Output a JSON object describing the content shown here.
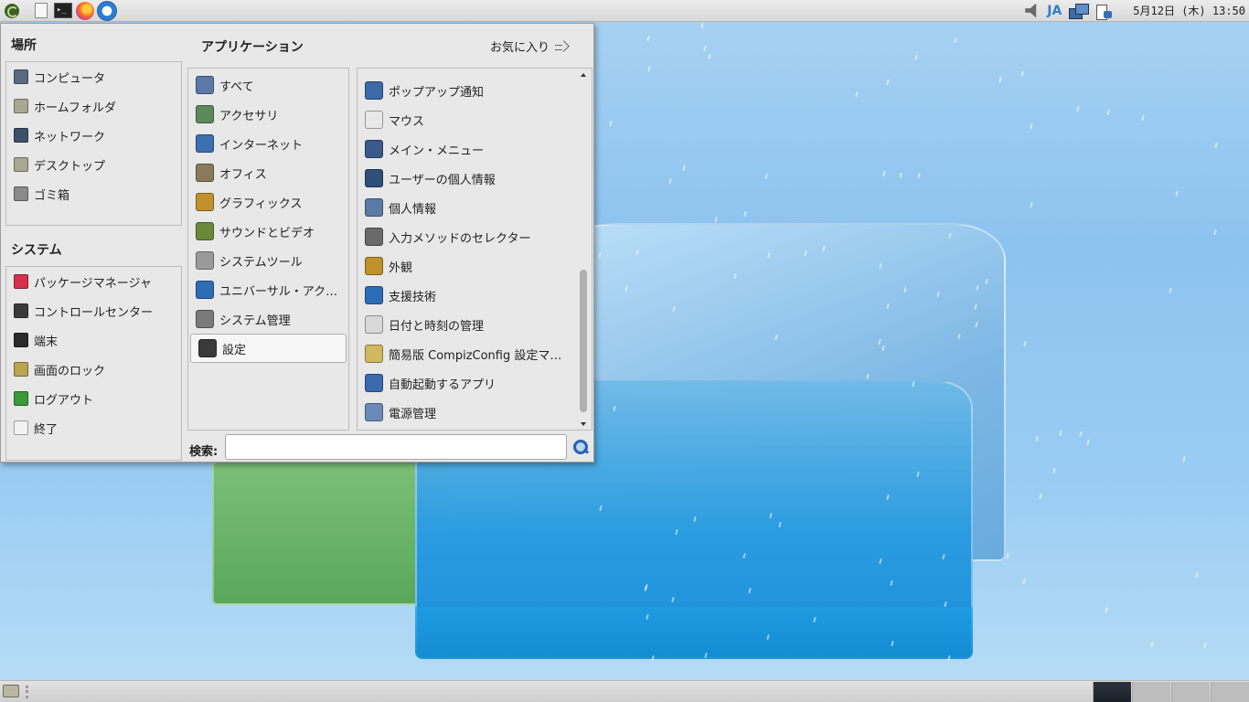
{
  "top_panel": {
    "launchers": [
      "whisker-menu",
      "file-manager",
      "terminal",
      "firefox",
      "thunderbird"
    ],
    "tray": {
      "input_method": "JA"
    },
    "clock": "5月12日 (木) 13:50"
  },
  "menu": {
    "places_title": "場所",
    "places": [
      {
        "label": "コンピュータ",
        "icon": "computer-icon",
        "color": "#5a6a80"
      },
      {
        "label": "ホームフォルダ",
        "icon": "home-folder-icon",
        "color": "#a7a890"
      },
      {
        "label": "ネットワーク",
        "icon": "network-icon",
        "color": "#3f5068"
      },
      {
        "label": "デスクトップ",
        "icon": "desktop-folder-icon",
        "color": "#a7a890"
      },
      {
        "label": "ゴミ箱",
        "icon": "trash-icon",
        "color": "#8a8a8a"
      }
    ],
    "system_title": "システム",
    "system": [
      {
        "label": "パッケージマネージャ",
        "icon": "package-icon",
        "color": "#d6304a"
      },
      {
        "label": "コントロールセンター",
        "icon": "control-center-icon",
        "color": "#3a3a3a"
      },
      {
        "label": "端末",
        "icon": "terminal-icon",
        "color": "#2a2a2a"
      },
      {
        "label": "画面のロック",
        "icon": "lock-screen-icon",
        "color": "#b9a450"
      },
      {
        "label": "ログアウト",
        "icon": "logout-icon",
        "color": "#3b9a3a"
      },
      {
        "label": "終了",
        "icon": "shutdown-icon",
        "color": "#f2f2f2"
      }
    ],
    "apps_title": "アプリケーション",
    "favorites_label": "お気に入り",
    "categories": [
      {
        "label": "すべて",
        "icon": "all-apps-icon",
        "color": "#5b79a8"
      },
      {
        "label": "アクセサリ",
        "icon": "accessories-icon",
        "color": "#5a8a5a"
      },
      {
        "label": "インターネット",
        "icon": "internet-icon",
        "color": "#3e6fb0"
      },
      {
        "label": "オフィス",
        "icon": "office-icon",
        "color": "#8a7a5a"
      },
      {
        "label": "グラフィックス",
        "icon": "graphics-icon",
        "color": "#c0902a"
      },
      {
        "label": "サウンドとビデオ",
        "icon": "sound-video-icon",
        "color": "#6a8a3a"
      },
      {
        "label": "システムツール",
        "icon": "system-tools-icon",
        "color": "#9a9a9a"
      },
      {
        "label": "ユニバーサル・アク…",
        "icon": "universal-access-icon",
        "color": "#2d6db5"
      },
      {
        "label": "システム管理",
        "icon": "system-admin-icon",
        "color": "#7a7a7a"
      },
      {
        "label": "設定",
        "icon": "settings-icon",
        "color": "#3a3a3a"
      }
    ],
    "selected_category": "設定",
    "apps": [
      {
        "label": "ポップアップ通知",
        "icon": "popup-notification-icon",
        "color": "#3d6aa8"
      },
      {
        "label": "マウス",
        "icon": "mouse-icon",
        "color": "#e8e8e8"
      },
      {
        "label": "メイン・メニュー",
        "icon": "main-menu-icon",
        "color": "#3a5a8a"
      },
      {
        "label": "ユーザーの個人情報",
        "icon": "user-info-icon",
        "color": "#2f4f7a"
      },
      {
        "label": "個人情報",
        "icon": "personal-info-icon",
        "color": "#5a7aa8"
      },
      {
        "label": "入力メソッドのセレクター",
        "icon": "input-method-icon",
        "color": "#6a6a6a"
      },
      {
        "label": "外観",
        "icon": "appearance-icon",
        "color": "#c0902a"
      },
      {
        "label": "支援技術",
        "icon": "assistive-tech-icon",
        "color": "#2d6db5"
      },
      {
        "label": "日付と時刻の管理",
        "icon": "clock-icon",
        "color": "#d8d8d8"
      },
      {
        "label": "簡易版 CompizConfig 設定マ…",
        "icon": "compiz-icon",
        "color": "#d0b860"
      },
      {
        "label": "自動起動するアプリ",
        "icon": "autostart-icon",
        "color": "#3a6ab0"
      },
      {
        "label": "電源管理",
        "icon": "power-manager-icon",
        "color": "#6a8ab8"
      }
    ],
    "search": {
      "label": "検索:",
      "value": ""
    }
  }
}
